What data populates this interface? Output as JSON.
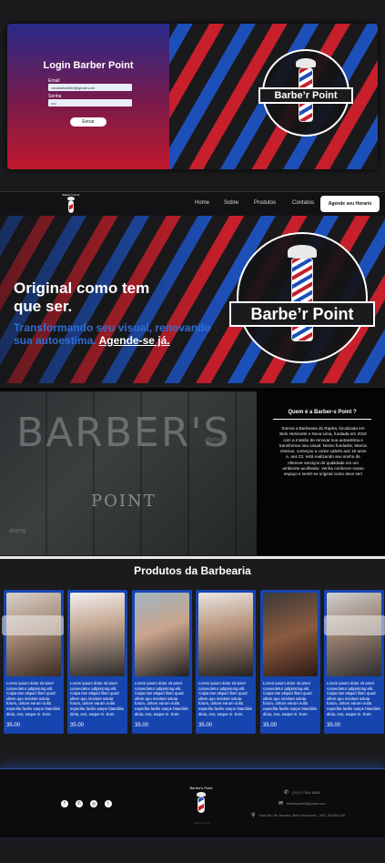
{
  "login": {
    "title": "Login Barber Point",
    "email_label": "Email",
    "email_value": "contatobarberf@gmail.com",
    "password_label": "Senha",
    "password_value": "••••",
    "submit_label": "Entrar"
  },
  "brand": {
    "logo_text": "Barbe’r Point",
    "nav_logo_text": "Barber's Point"
  },
  "nav": {
    "items": [
      "Home",
      "Sobre",
      "Produtos",
      "Contatos"
    ],
    "cta": "Agende seu Horario"
  },
  "hero": {
    "title": "Original como tem que ser.",
    "subtitle": "Transformando seu visual, renovando sua autoestima.",
    "cta": "Agende-se já."
  },
  "about": {
    "image_text_big": "BARBER'S",
    "image_text_small": "POINT",
    "watermark": "alamy",
    "heading": "Quem é a Barber-s Point ?",
    "text": "Somos a Barbearia do Rapha, localizada em Belo Horizonte e Nova Lima, fundada em 2019 com a missão de renovar sua autoestima e transformar seu visual. Nosso fundador, Marcio Vinicius, começou a cortar cabelo aos 15 anos e, aos 22, está realizando seu sonho de oferecer serviços de qualidade em um ambiente acolhedor. Venha conhecer nosso espaço e sentir-se original como deve ser!"
  },
  "products": {
    "title": "Produtos da Barbearia",
    "items": [
      {
        "desc": "Lorem ipsum dolor sit amet consectetur adipisicing elit. Culpa iste aliquid illum quod ullam quo incidunt soluta forum, dolore earum nulla expedita facilis saepe blanditiis dicta, eos, eaque in. Eum.",
        "price": "35.00"
      },
      {
        "desc": "Lorem ipsum dolor sit amet consectetur adipisicing elit. Culpa iste aliquid illum quod ullam quo incidunt soluta forum, dolore earum nulla expedita facilis saepe blanditiis dicta, eos, eaque in. Eum.",
        "price": "35.00"
      },
      {
        "desc": "Lorem ipsum dolor sit amet consectetur adipisicing elit. Culpa iste aliquid illum quod ullam quo incidunt soluta forum, dolore earum nulla expedita facilis saepe blanditiis dicta, eos, eaque in. Eum.",
        "price": "35.00"
      },
      {
        "desc": "Lorem ipsum dolor sit amet consectetur adipisicing elit. Culpa iste aliquid illum quod ullam quo incidunt soluta forum, dolore earum nulla expedita facilis saepe blanditiis dicta, eos, eaque in. Eum.",
        "price": "35.00"
      },
      {
        "desc": "Lorem ipsum dolor sit amet consectetur adipisicing elit. Culpa iste aliquid illum quod ullam quo incidunt soluta forum, dolore earum nulla expedita facilis saepe blanditiis dicta, eos, eaque in. Eum.",
        "price": "35.00"
      },
      {
        "desc": "Lorem ipsum dolor sit amet consectetur adipisicing elit. Culpa iste aliquid illum quod ullam quo incidunt soluta forum, dolore earum nulla expedita facilis saepe blanditiis dicta, eos, eaque in. Eum.",
        "price": "35.00"
      }
    ]
  },
  "footer": {
    "social_icons": [
      "facebook-icon",
      "whatsapp-icon",
      "instagram-icon",
      "twitter-icon"
    ],
    "logo_caption": "Barber's Point",
    "phone": "(31) 9 7544-8898",
    "email": "barberpoint@gmail.com",
    "address": "Rua Rio de Janeiro, Belo Horizonte - MG, 30160-040"
  },
  "colors": {
    "accent_blue": "#1d4fb8",
    "accent_red": "#c71f2b",
    "background": "#1b1b1d"
  }
}
